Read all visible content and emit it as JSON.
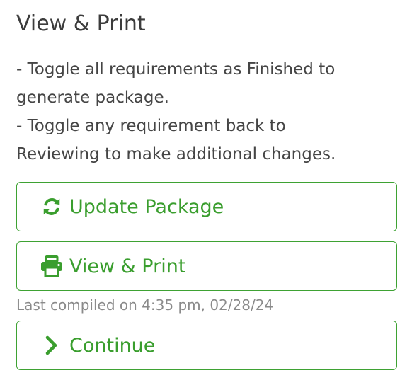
{
  "panel": {
    "title": "View & Print",
    "instructions": [
      "- Toggle all requirements as Finished to",
      "generate package.",
      "- Toggle any requirement back to",
      "Reviewing to make additional changes."
    ]
  },
  "buttons": {
    "update": {
      "label": "Update Package",
      "icon": "refresh-icon"
    },
    "print": {
      "label": "View & Print",
      "icon": "printer-icon"
    },
    "continue": {
      "label": "Continue",
      "icon": "chevron-right-icon"
    }
  },
  "status": {
    "last_compiled": "Last compiled on 4:35 pm, 02/28/24"
  },
  "colors": {
    "accent": "#3a9e2e",
    "text": "#404040",
    "muted": "#8a8a8a"
  }
}
